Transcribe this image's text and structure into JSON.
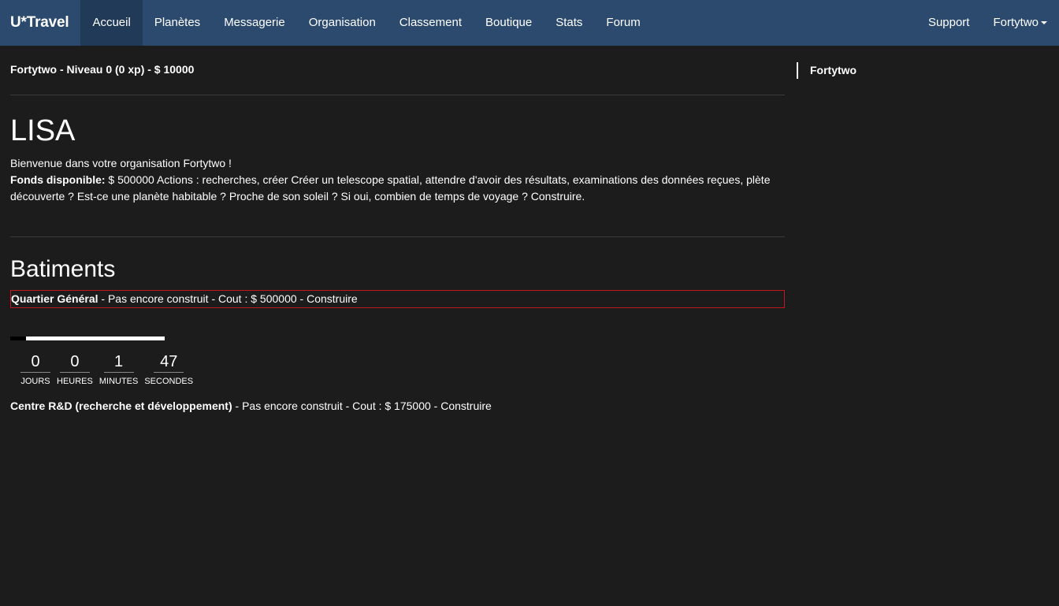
{
  "navbar": {
    "brand": "U*Travel",
    "items": [
      {
        "label": "Accueil"
      },
      {
        "label": "Planètes"
      },
      {
        "label": "Messagerie"
      },
      {
        "label": "Organisation"
      },
      {
        "label": "Classement"
      },
      {
        "label": "Boutique"
      },
      {
        "label": "Stats"
      },
      {
        "label": "Forum"
      }
    ],
    "right": {
      "support": "Support",
      "user": "Fortytwo"
    }
  },
  "main": {
    "user_line": "Fortytwo - Niveau 0 (0 xp) - $ 10000",
    "org_title": "LISA",
    "welcome": "Bienvenue dans votre organisation Fortytwo !",
    "funds_label": "Fonds disponible:",
    "funds_text": " $ 500000 Actions : recherches, créer Créer un telescope spatial, attendre d'avoir des résultats, examinations des données reçues, plète découverte ? Est-ce une planète habitable ? Proche de son soleil ? Si oui, combien de temps de voyage ? Construire.",
    "batiments_title": "Batiments",
    "buildings": [
      {
        "name": "Quartier Général",
        "detail": " - Pas encore construit - Cout : $ 500000 - Construire"
      },
      {
        "name": "Centre R&D (recherche et développement)",
        "detail": " - Pas encore construit - Cout : $ 175000 - Construire"
      }
    ],
    "progress_fraction": 0.1,
    "countdown": [
      {
        "value": "0",
        "label": "JOURS"
      },
      {
        "value": "0",
        "label": "HEURES"
      },
      {
        "value": "1",
        "label": "MINUTES"
      },
      {
        "value": "47",
        "label": "SECONDES"
      }
    ]
  },
  "sidebar": {
    "label": "Fortytwo"
  }
}
